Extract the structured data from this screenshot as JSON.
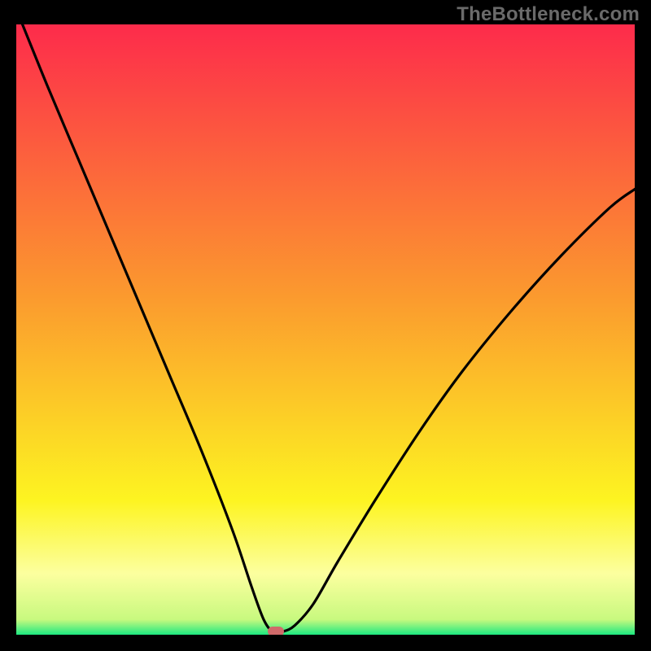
{
  "watermark": {
    "text": "TheBottleneck.com"
  },
  "colors": {
    "red": "#fd2b4b",
    "orange": "#fb9b2e",
    "yellow": "#fdf421",
    "paleyellow": "#fcff9f",
    "green": "#1ce980",
    "black": "#000000",
    "curve": "#000000",
    "marker": "#d06a6a"
  },
  "chart_data": {
    "type": "line",
    "title": "",
    "xlabel": "",
    "ylabel": "",
    "xlim": [
      0,
      100
    ],
    "ylim": [
      0,
      100
    ],
    "note": "Axes are un-ticked; values are normalized 0-100 by reading pixel positions. Lower y = better (green zone). The marker sits at the curve minimum.",
    "series": [
      {
        "name": "bottleneck-curve",
        "x": [
          1,
          5,
          10,
          15,
          20,
          25,
          30,
          35,
          38,
          40,
          41.5,
          43,
          45,
          48,
          52,
          58,
          65,
          72,
          80,
          88,
          96,
          100
        ],
        "y": [
          100,
          90,
          78,
          66,
          54,
          42,
          30,
          17,
          8,
          2.5,
          0.5,
          0.5,
          1.5,
          5,
          12,
          22,
          33,
          43,
          53,
          62,
          70,
          73
        ]
      }
    ],
    "marker": {
      "x": 42,
      "y": 0.5
    },
    "gradient_stops": [
      {
        "pos": 0.0,
        "color": "#fd2b4b"
      },
      {
        "pos": 0.45,
        "color": "#fb9b2e"
      },
      {
        "pos": 0.78,
        "color": "#fdf421"
      },
      {
        "pos": 0.9,
        "color": "#fcff9f"
      },
      {
        "pos": 0.975,
        "color": "#c8f97f"
      },
      {
        "pos": 1.0,
        "color": "#1ce980"
      }
    ]
  }
}
